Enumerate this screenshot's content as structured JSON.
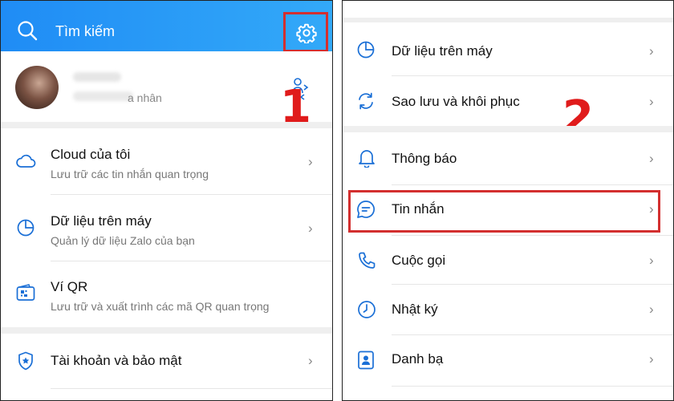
{
  "left": {
    "search": {
      "placeholder": "Tìm kiếm"
    },
    "profile": {
      "sub_suffix": "a nhân"
    },
    "step_label": "1",
    "items": [
      {
        "title": "Cloud của tôi",
        "sub": "Lưu trữ các tin nhắn quan trọng",
        "icon": "cloud-icon"
      },
      {
        "title": "Dữ liệu trên máy",
        "sub": "Quản lý dữ liệu Zalo của bạn",
        "icon": "pie-chart-icon"
      },
      {
        "title": "Ví QR",
        "sub": "Lưu trữ và xuất trình các mã QR quan trọng",
        "icon": "qr-wallet-icon"
      },
      {
        "title": "Tài khoản và bảo mật",
        "icon": "shield-icon"
      }
    ]
  },
  "right": {
    "step_label": "2",
    "items": [
      {
        "title": "Dữ liệu trên máy",
        "icon": "pie-chart-icon"
      },
      {
        "title": "Sao lưu và khôi phục",
        "icon": "sync-icon"
      },
      {
        "title": "Thông báo",
        "icon": "bell-icon"
      },
      {
        "title": "Tin nhắn",
        "icon": "message-icon"
      },
      {
        "title": "Cuộc gọi",
        "icon": "phone-icon"
      },
      {
        "title": "Nhật ký",
        "icon": "clock-icon"
      },
      {
        "title": "Danh bạ",
        "icon": "contacts-icon"
      }
    ]
  },
  "colors": {
    "accent": "#1f8cf5",
    "icon": "#1a6fd6",
    "highlight": "#d32f2f",
    "step_number": "#e01b1b"
  },
  "chevron": "›"
}
